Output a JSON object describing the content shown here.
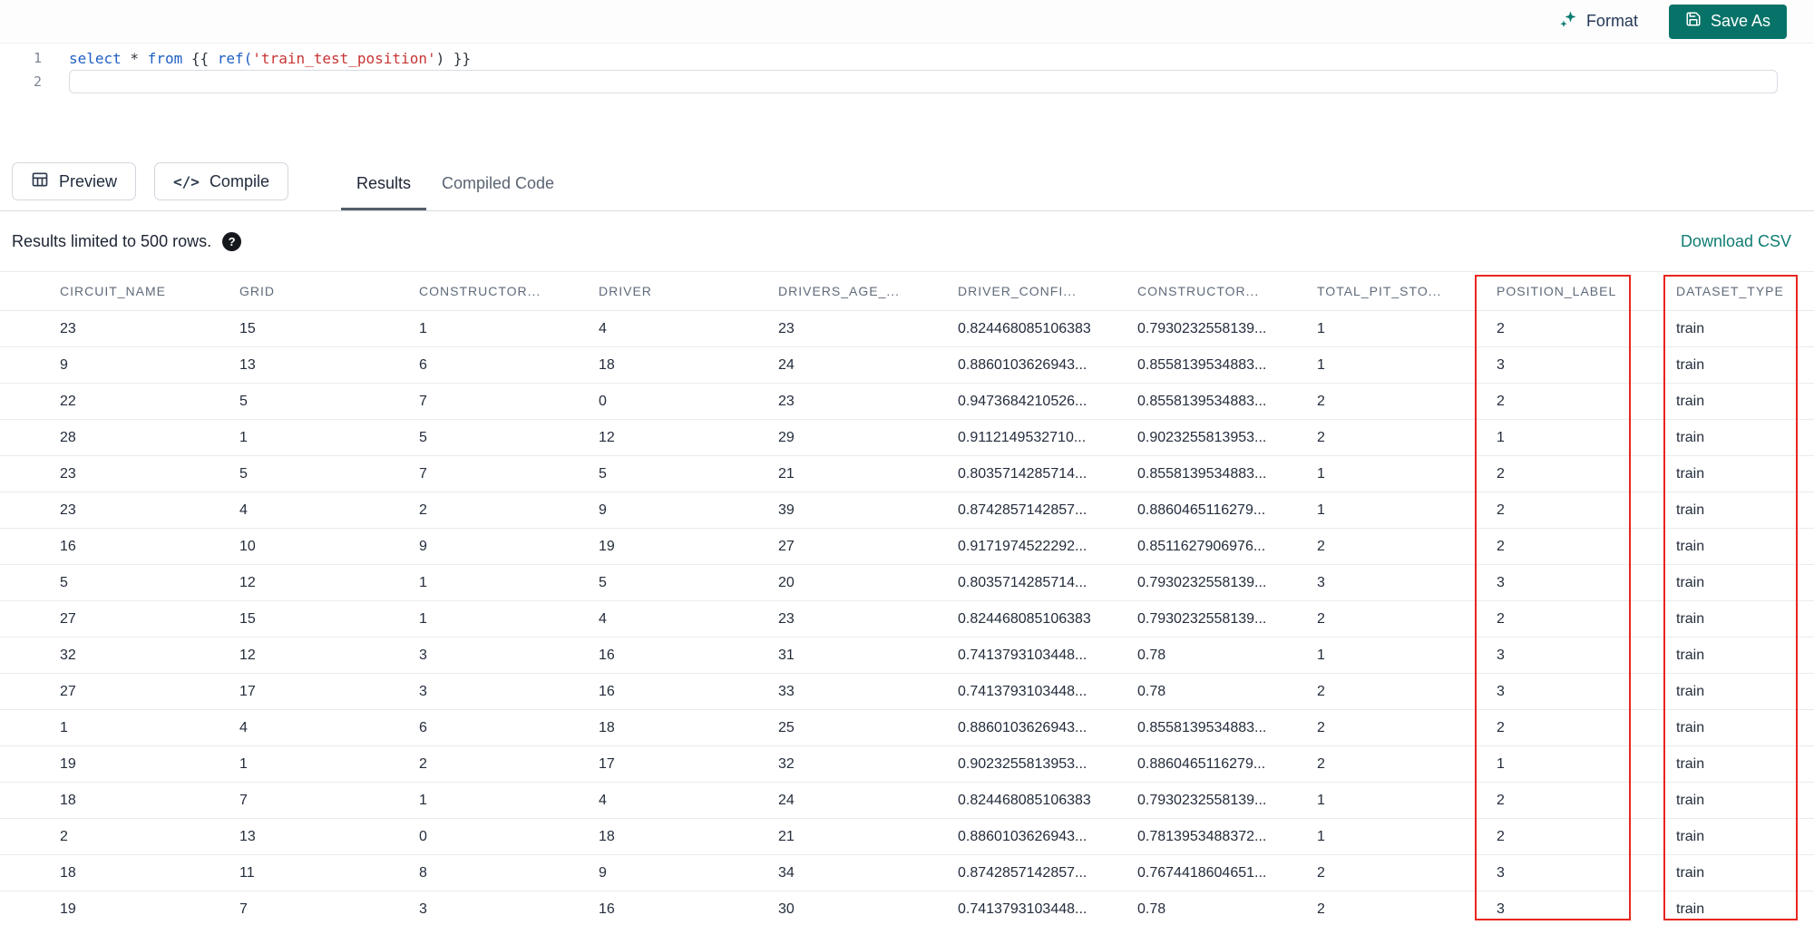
{
  "toolbar": {
    "format_label": "Format",
    "save_as_label": "Save As"
  },
  "editor": {
    "line_numbers": [
      "1",
      "2"
    ],
    "line1": {
      "kw_select": "select",
      "op_star": " * ",
      "kw_from": "from",
      "punct_open": " {{ ",
      "fn_ref": "ref(",
      "str_model": "'train_test_position'",
      "punct_close": ") }}"
    }
  },
  "actions": {
    "preview_label": "Preview",
    "compile_label": "Compile",
    "compile_icon_glyph": "</>"
  },
  "tabs": [
    {
      "label": "Results",
      "active": true
    },
    {
      "label": "Compiled Code",
      "active": false
    }
  ],
  "results_bar": {
    "limit_text": "Results limited to 500 rows.",
    "help_icon_glyph": "?",
    "download_csv_label": "Download CSV"
  },
  "table": {
    "columns": [
      "CIRCUIT_NAME",
      "GRID",
      "CONSTRUCTOR...",
      "DRIVER",
      "DRIVERS_AGE_...",
      "DRIVER_CONFI...",
      "CONSTRUCTOR...",
      "TOTAL_PIT_STO...",
      "POSITION_LABEL",
      "DATASET_TYPE"
    ],
    "rows": [
      [
        "23",
        "15",
        "1",
        "4",
        "23",
        "0.824468085106383",
        "0.7930232558139...",
        "1",
        "2",
        "train"
      ],
      [
        "9",
        "13",
        "6",
        "18",
        "24",
        "0.8860103626943...",
        "0.8558139534883...",
        "1",
        "3",
        "train"
      ],
      [
        "22",
        "5",
        "7",
        "0",
        "23",
        "0.9473684210526...",
        "0.8558139534883...",
        "2",
        "2",
        "train"
      ],
      [
        "28",
        "1",
        "5",
        "12",
        "29",
        "0.9112149532710...",
        "0.9023255813953...",
        "2",
        "1",
        "train"
      ],
      [
        "23",
        "5",
        "7",
        "5",
        "21",
        "0.8035714285714...",
        "0.8558139534883...",
        "1",
        "2",
        "train"
      ],
      [
        "23",
        "4",
        "2",
        "9",
        "39",
        "0.8742857142857...",
        "0.8860465116279...",
        "1",
        "2",
        "train"
      ],
      [
        "16",
        "10",
        "9",
        "19",
        "27",
        "0.9171974522292...",
        "0.8511627906976...",
        "2",
        "2",
        "train"
      ],
      [
        "5",
        "12",
        "1",
        "5",
        "20",
        "0.8035714285714...",
        "0.7930232558139...",
        "3",
        "3",
        "train"
      ],
      [
        "27",
        "15",
        "1",
        "4",
        "23",
        "0.824468085106383",
        "0.7930232558139...",
        "2",
        "2",
        "train"
      ],
      [
        "32",
        "12",
        "3",
        "16",
        "31",
        "0.7413793103448...",
        "0.78",
        "1",
        "3",
        "train"
      ],
      [
        "27",
        "17",
        "3",
        "16",
        "33",
        "0.7413793103448...",
        "0.78",
        "2",
        "3",
        "train"
      ],
      [
        "1",
        "4",
        "6",
        "18",
        "25",
        "0.8860103626943...",
        "0.8558139534883...",
        "2",
        "2",
        "train"
      ],
      [
        "19",
        "1",
        "2",
        "17",
        "32",
        "0.9023255813953...",
        "0.8860465116279...",
        "2",
        "1",
        "train"
      ],
      [
        "18",
        "7",
        "1",
        "4",
        "24",
        "0.824468085106383",
        "0.7930232558139...",
        "1",
        "2",
        "train"
      ],
      [
        "2",
        "13",
        "0",
        "18",
        "21",
        "0.8860103626943...",
        "0.7813953488372...",
        "1",
        "2",
        "train"
      ],
      [
        "18",
        "11",
        "8",
        "9",
        "34",
        "0.8742857142857...",
        "0.7674418604651...",
        "2",
        "3",
        "train"
      ],
      [
        "19",
        "7",
        "3",
        "16",
        "30",
        "0.7413793103448...",
        "0.78",
        "2",
        "3",
        "train"
      ]
    ]
  },
  "colors": {
    "accent_teal": "#077368",
    "link_teal": "#0f7d72",
    "highlight_red": "#e8251f"
  }
}
